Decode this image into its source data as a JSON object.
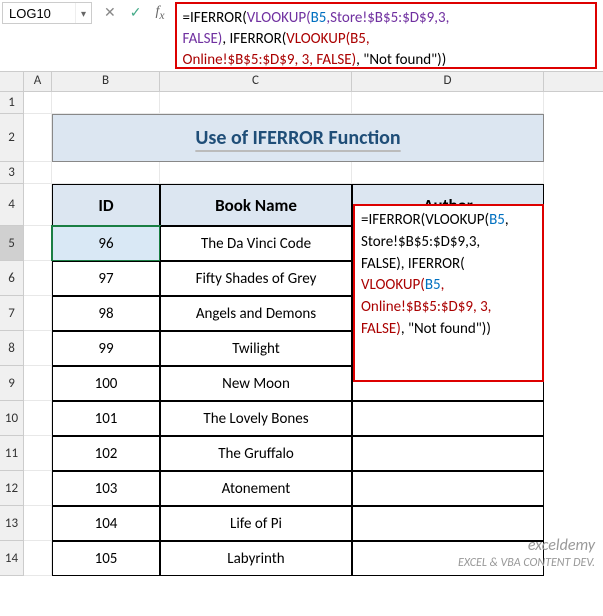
{
  "nameBox": {
    "value": "LOG10"
  },
  "formulaBar": "=IFERROR(VLOOKUP(B5,Store!$B$5:$D$9,3,FALSE), IFERROR(VLOOKUP(B5,Online!$B$5:$D$9, 3, FALSE), \"Not found\"))",
  "columns": {
    "A": "A",
    "B": "B",
    "C": "C",
    "D": "D"
  },
  "rows": [
    "1",
    "2",
    "3",
    "4",
    "5",
    "6",
    "7",
    "8",
    "9",
    "10",
    "11",
    "12",
    "13",
    "14"
  ],
  "title": "Use of IFERROR Function",
  "headers": {
    "id": "ID",
    "book": "Book Name",
    "author": "Author"
  },
  "data": [
    {
      "id": "96",
      "book": "The Da Vinci Code"
    },
    {
      "id": "97",
      "book": "Fifty Shades of Grey"
    },
    {
      "id": "98",
      "book": "Angels and Demons"
    },
    {
      "id": "99",
      "book": "Twilight"
    },
    {
      "id": "100",
      "book": "New Moon"
    },
    {
      "id": "101",
      "book": "The Lovely Bones"
    },
    {
      "id": "102",
      "book": "The Gruffalo"
    },
    {
      "id": "103",
      "book": "Atonement"
    },
    {
      "id": "104",
      "book": "Life of Pi"
    },
    {
      "id": "105",
      "book": "Labyrinth"
    }
  ],
  "cellFormula": "=IFERROR(VLOOKUP(B5,Store!$B$5:$D$9,3,FALSE), IFERROR(VLOOKUP(B5,Online!$B$5:$D$9, 3, FALSE), \"Not found\"))",
  "watermark": {
    "line1": "exceldemy",
    "line2": "EXCEL & VBA CONTENT DEV."
  },
  "chart_data": {
    "type": "table",
    "title": "Use of IFERROR Function",
    "columns": [
      "ID",
      "Book Name",
      "Author"
    ],
    "rows": [
      [
        96,
        "The Da Vinci Code",
        ""
      ],
      [
        97,
        "Fifty Shades of Grey",
        ""
      ],
      [
        98,
        "Angels and Demons",
        ""
      ],
      [
        99,
        "Twilight",
        ""
      ],
      [
        100,
        "New Moon",
        ""
      ],
      [
        101,
        "The Lovely Bones",
        ""
      ],
      [
        102,
        "The Gruffalo",
        ""
      ],
      [
        103,
        "Atonement",
        ""
      ],
      [
        104,
        "Life of Pi",
        ""
      ],
      [
        105,
        "Labyrinth",
        ""
      ]
    ]
  }
}
